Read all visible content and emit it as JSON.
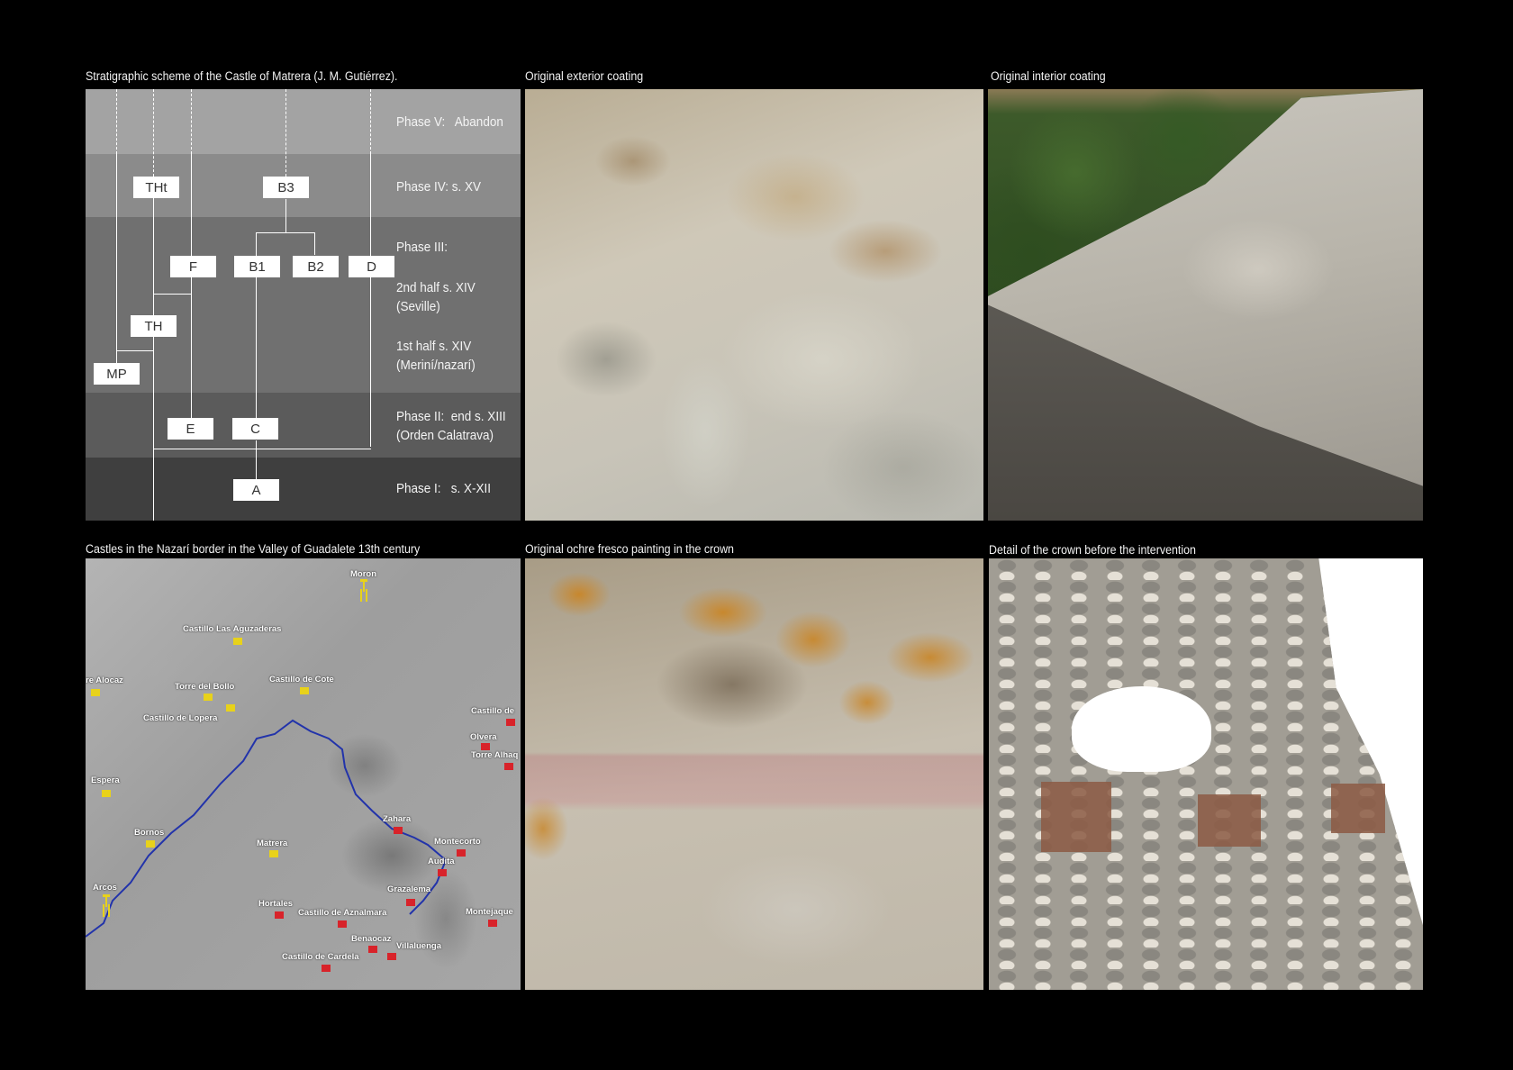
{
  "captions": {
    "scheme": "Stratigraphic scheme of the Castle of Matrera (J. M. Gutiérrez).",
    "exterior": "Original exterior coating",
    "interior": "Original interior coating",
    "map": "Castles in the Nazarí border in the Valley of Guadalete 13th century",
    "ochre": "Original ochre fresco painting in the crown",
    "crown": "Detail of the crown before the intervention"
  },
  "scheme": {
    "phases": [
      {
        "label": "Phase V:   Abandon"
      },
      {
        "label": "Phase IV: s. XV"
      },
      {
        "label": "Phase III:"
      },
      {
        "label": "2nd half s. XIV\n(Seville)"
      },
      {
        "label": "1st half s. XIV\n(Meriní/nazarí)"
      },
      {
        "label": "Phase II:  end s. XIII\n(Orden Calatrava)"
      },
      {
        "label": "Phase I:   s. X-XII"
      }
    ],
    "units": {
      "tht": "THt",
      "b3": "B3",
      "f": "F",
      "b1": "B1",
      "b2": "B2",
      "d": "D",
      "th": "TH",
      "mp": "MP",
      "e": "E",
      "c": "C",
      "a": "A"
    },
    "band_colors": [
      "#a3a3a3",
      "#8b8b8b",
      "#707070",
      "#5b5b5b",
      "#3f3f3f"
    ]
  },
  "map": {
    "places": [
      {
        "name": "Moron",
        "marker": "pin"
      },
      {
        "name": "Castillo Las Aguzaderas",
        "marker": "yellow"
      },
      {
        "name": "re Alocaz",
        "marker": "yellow"
      },
      {
        "name": "Torre del Bollo",
        "marker": "yellow"
      },
      {
        "name": "Castillo de Cote",
        "marker": "yellow"
      },
      {
        "name": "Castillo de Lopera",
        "marker": "yellow"
      },
      {
        "name": "Castillo de",
        "marker": "red"
      },
      {
        "name": "Olvera",
        "marker": "red"
      },
      {
        "name": "Torre Alhaq",
        "marker": "red"
      },
      {
        "name": "Espera",
        "marker": "yellow"
      },
      {
        "name": "Zahara",
        "marker": "red"
      },
      {
        "name": "Montecorto",
        "marker": "red"
      },
      {
        "name": "Bornos",
        "marker": "yellow"
      },
      {
        "name": "Matrera",
        "marker": "yellow"
      },
      {
        "name": "Audita",
        "marker": "red"
      },
      {
        "name": "Grazalema",
        "marker": "red"
      },
      {
        "name": "Arcos",
        "marker": "pin"
      },
      {
        "name": "Hortales",
        "marker": "red"
      },
      {
        "name": "Castillo de Aznalmara",
        "marker": "red"
      },
      {
        "name": "Montejaque",
        "marker": "red"
      },
      {
        "name": "Benaocaz",
        "marker": "red"
      },
      {
        "name": "Villaluenga",
        "marker": "red"
      },
      {
        "name": "Castillo de Cardela",
        "marker": "red"
      }
    ],
    "colors": {
      "border_castle": "#d8232a",
      "christian_castle": "#e8d21a",
      "river": "#2233aa"
    }
  }
}
